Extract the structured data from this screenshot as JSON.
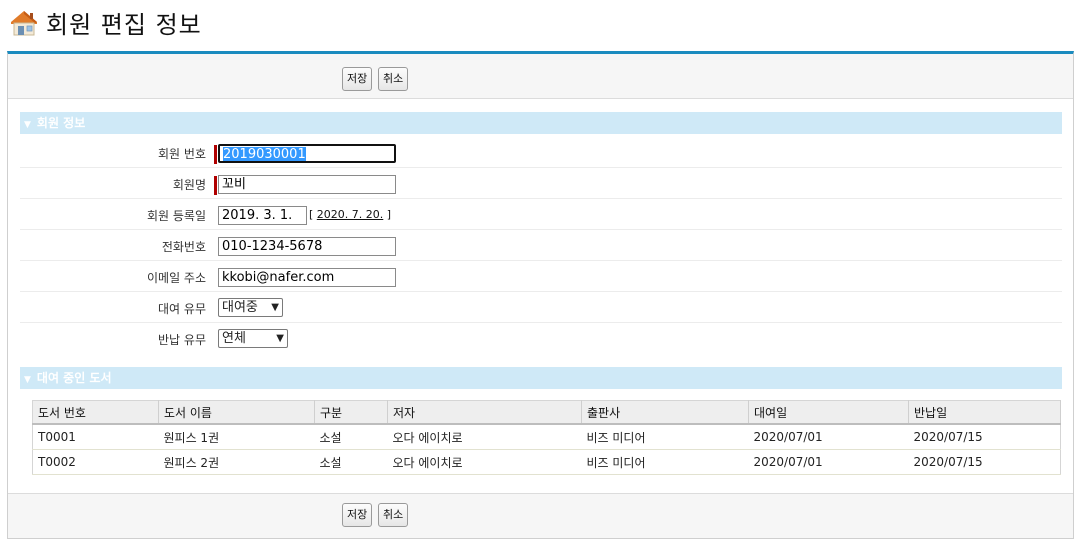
{
  "page": {
    "title": "회원 편집 정보"
  },
  "toolbar": {
    "save_label": "저장",
    "cancel_label": "취소"
  },
  "member_section": {
    "title": "회원 정보",
    "fields": {
      "member_no": {
        "label": "회원 번호",
        "value": "2019030001"
      },
      "name": {
        "label": "회원명",
        "value": "꼬비"
      },
      "reg_date": {
        "label": "회원 등록일",
        "value": "2019. 3. 1.",
        "link_open": "[",
        "link_date": "2020. 7. 20.",
        "link_close": "]"
      },
      "phone": {
        "label": "전화번호",
        "value": "010-1234-5678"
      },
      "email": {
        "label": "이메일 주소",
        "value": "kkobi@nafer.com"
      },
      "rental": {
        "label": "대여 유무",
        "value": "대여중"
      },
      "return": {
        "label": "반납 유무",
        "value": "연체"
      }
    }
  },
  "books_section": {
    "title": "대여 중인 도서",
    "columns": [
      "도서 번호",
      "도서 이름",
      "구분",
      "저자",
      "출판사",
      "대여일",
      "반납일"
    ],
    "rows": [
      [
        "T0001",
        "원피스 1권",
        "소설",
        "오다 에이치로",
        "비즈 미디어",
        "2020/07/01",
        "2020/07/15"
      ],
      [
        "T0002",
        "원피스 2권",
        "소설",
        "오다 에이치로",
        "비즈 미디어",
        "2020/07/01",
        "2020/07/15"
      ]
    ]
  },
  "colors": {
    "accent": "#1a8bbf",
    "section_bg": "#cfe9f7",
    "required": "#b00000",
    "selection": "#3399ff"
  }
}
